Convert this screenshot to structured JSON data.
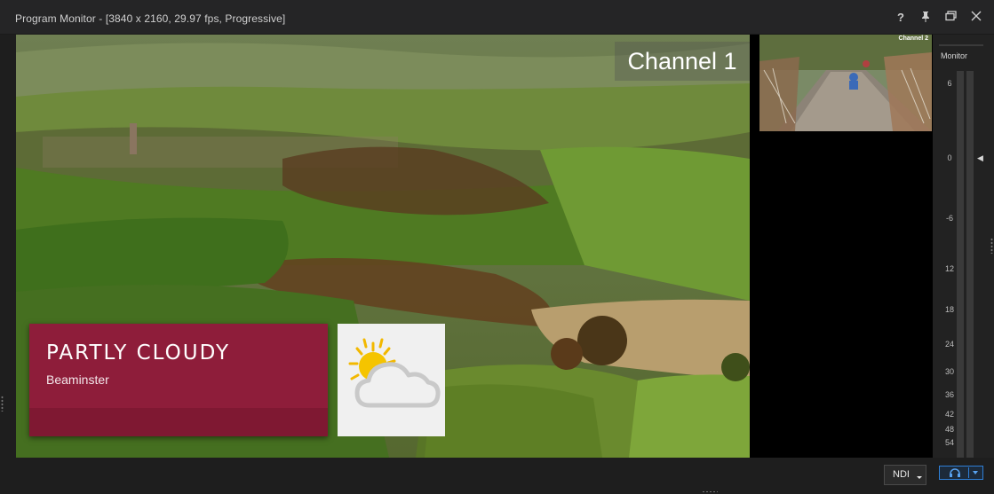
{
  "window": {
    "title": "Program Monitor - [3840 x 2160, 29.97 fps, Progressive]",
    "buttons": {
      "help_label": "?",
      "pin_icon": "pin-icon",
      "restore_icon": "restore-icon",
      "close_icon": "close-icon"
    }
  },
  "program": {
    "channel_label": "Channel 1",
    "lower_third": {
      "headline": "PARTLY CLOUDY",
      "subtitle": "Beaminster",
      "color": "#8e1d3a"
    },
    "weather_icon": "partly-cloudy-icon"
  },
  "preview": {
    "channel_label": "Channel 2"
  },
  "meter": {
    "label": "Monitor",
    "scale": [
      "6",
      "0",
      "-6",
      "12",
      "18",
      "24",
      "30",
      "36",
      "42",
      "48",
      "54"
    ]
  },
  "footer": {
    "output_select": "NDI",
    "audio_icon": "headphones-icon",
    "accent_color": "#2f7fd6"
  }
}
